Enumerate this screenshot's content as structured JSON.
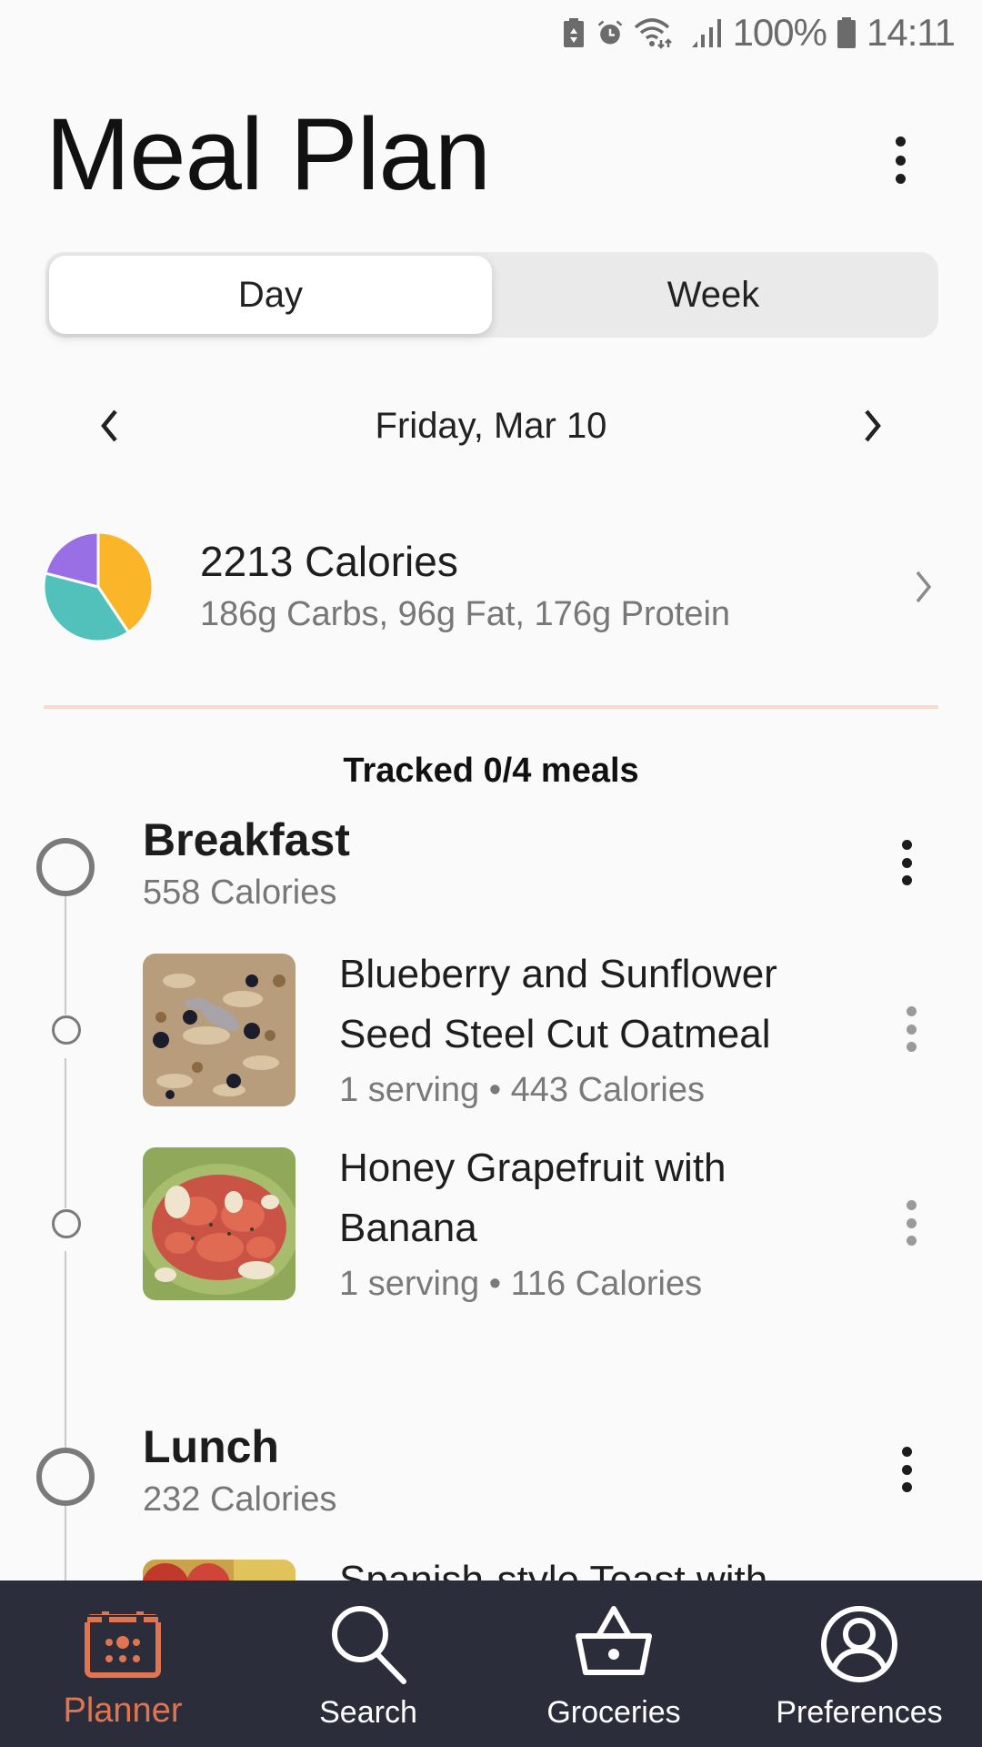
{
  "status_bar": {
    "icons": [
      "battery-saver-icon",
      "alarm-icon",
      "wifi-icon",
      "signal-icon",
      "battery-icon"
    ],
    "battery": "100%",
    "time": "14:11"
  },
  "header": {
    "title": "Meal Plan",
    "menu_icon": "more-vertical-icon"
  },
  "view_toggle": {
    "options": [
      {
        "label": "Day",
        "selected": true
      },
      {
        "label": "Week",
        "selected": false
      }
    ]
  },
  "date_nav": {
    "prev_icon": "chevron-left-icon",
    "date": "Friday, Mar 10",
    "next_icon": "chevron-right-icon"
  },
  "summary": {
    "calories": "2213 Calories",
    "macros": "186g Carbs, 96g Fat, 176g Protein",
    "macro_chart": {
      "type": "pie",
      "slices": [
        {
          "name": "Carbs",
          "grams": 186,
          "color": "#fbb528"
        },
        {
          "name": "Protein",
          "grams": 176,
          "color": "#52c1bb"
        },
        {
          "name": "Fat",
          "grams": 96,
          "color": "#9a6fe6"
        }
      ]
    }
  },
  "tracked": "Tracked 0/4 meals",
  "meals": [
    {
      "name": "Breakfast",
      "calories": "558 Calories",
      "items": [
        {
          "name": "Blueberry and Sunflower Seed Steel Cut Oatmeal",
          "meta": "1 serving • 443 Calories",
          "image": "oatmeal-photo"
        },
        {
          "name": "Honey Grapefruit with Banana",
          "meta": "1 serving • 116 Calories",
          "image": "grapefruit-photo"
        }
      ]
    },
    {
      "name": "Lunch",
      "calories": "232 Calories",
      "items": [
        {
          "name": "Spanish-style Toast with",
          "meta": "",
          "image": "toast-photo"
        }
      ]
    }
  ],
  "bottom_nav": {
    "items": [
      {
        "label": "Planner",
        "icon": "calendar-icon",
        "active": true
      },
      {
        "label": "Search",
        "icon": "search-icon",
        "active": false
      },
      {
        "label": "Groceries",
        "icon": "basket-icon",
        "active": false
      },
      {
        "label": "Preferences",
        "icon": "profile-icon",
        "active": false
      }
    ]
  },
  "colors": {
    "accent": "#e07552",
    "nav_bg": "#2c2d3b",
    "divider": "#f9d9cc"
  }
}
